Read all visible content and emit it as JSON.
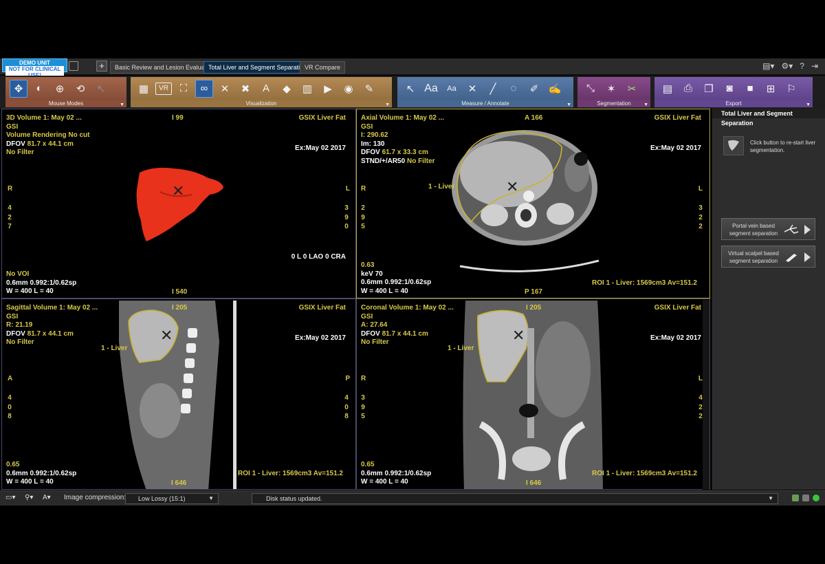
{
  "titlebar": {
    "demo_line1": "DEMO UNIT",
    "demo_line2": "NOT FOR CLINICAL USE!",
    "add_tab": "+",
    "tabs": [
      {
        "label": "Basic Review and Lesion Evaluation"
      },
      {
        "label": "Total Liver and Segment Separation"
      },
      {
        "label": "VR Compare"
      }
    ],
    "right_icons": [
      "display-icon",
      "gear-icon",
      "help-icon",
      "exit-icon"
    ]
  },
  "toolbar": {
    "groups": [
      {
        "label": "Mouse Modes",
        "color": "#8a4f3a",
        "icons": [
          "pan-icon",
          "brightness-icon",
          "zoom-icon",
          "rotate-icon",
          "pointer-icon"
        ]
      },
      {
        "label": "Visualization",
        "color": "#9a7440",
        "icons": [
          "layout-icon",
          "vr-icon",
          "fullscreen-icon",
          "link-icon",
          "crosshair-icon",
          "reference-icon",
          "annotation-icon",
          "cube-icon",
          "volume-icon",
          "cine-icon",
          "filter-icon",
          "paint-icon"
        ]
      },
      {
        "label": "Measure / Annotate",
        "color": "#46678f",
        "icons": [
          "arrow-icon",
          "text-icon",
          "text-small-icon",
          "cross-icon",
          "line-icon",
          "ellipse-icon",
          "pen-icon",
          "freehand-icon"
        ]
      },
      {
        "label": "Segmentation",
        "color": "#6e3a70",
        "icons": [
          "spline-icon",
          "magic-wand-icon",
          "scissors-icon"
        ]
      },
      {
        "label": "Export",
        "color": "#624690",
        "icons": [
          "report-icon",
          "print-icon",
          "copy-icon",
          "camera-icon",
          "video-icon",
          "save-icon",
          "run-icon"
        ]
      }
    ]
  },
  "viewports": {
    "vr3d": {
      "tl": [
        "3D Volume 1: May 02 ...",
        "GSI",
        "Volume Rendering No cut",
        "DFOV ",
        "81.7 x 44.1 cm",
        "No Filter"
      ],
      "top_center": "I 99",
      "tr": "GSIX Liver Fat",
      "exam": "Ex:May 02 2017",
      "left_orient": "R",
      "right_orient": "L",
      "left_nums": [
        "4",
        "2",
        "7"
      ],
      "right_nums": [
        "3",
        "9",
        "0"
      ],
      "angles": "0 L 0 LAO 0 CRA",
      "bl": [
        "No VOI",
        "0.6mm 0.992:1/0.62sp",
        "W = 400 L = 40"
      ],
      "bottom_center": "I 540"
    },
    "axial": {
      "tl": [
        "Axial Volume 1: May 02 ...",
        "GSI",
        "I: 290.62",
        "Im: 130",
        "DFOV ",
        "61.7 x 33.3 cm",
        "STND/+/AR50 ",
        "No Filter"
      ],
      "top_center": "A 166",
      "tr": "GSIX Liver Fat",
      "exam": "Ex:May 02 2017",
      "left_orient": "R",
      "right_orient": "L",
      "left_nums": [
        "2",
        "9",
        "5"
      ],
      "right_nums": [
        "3",
        "2",
        "2"
      ],
      "roi_label": "1 - Liver",
      "bl": [
        "0.63",
        "keV 70",
        "0.6mm 0.992:1/0.62sp",
        "W = 400 L = 40"
      ],
      "roi_stats": "ROI 1 - Liver: 1569cm3 Av=151.2",
      "bottom_center": "P 167"
    },
    "sagittal": {
      "tl": [
        "Sagittal Volume 1: May 02 ...",
        "GSI",
        "R: 21.19",
        "DFOV ",
        "81.7 x 44.1 cm",
        "No Filter"
      ],
      "top_center": "I 205",
      "tr": "GSIX Liver Fat",
      "exam": "Ex:May 02 2017",
      "left_orient": "A",
      "right_orient": "P",
      "left_nums": [
        "4",
        "0",
        "8"
      ],
      "right_nums": [
        "4",
        "0",
        "8"
      ],
      "roi_label": "1 - Liver",
      "bl": [
        "0.65",
        "0.6mm 0.992:1/0.62sp",
        "W = 400 L = 40"
      ],
      "roi_stats": "ROI 1 - Liver: 1569cm3 Av=151.2",
      "bottom_center": "I 646"
    },
    "coronal": {
      "tl": [
        "Coronal Volume 1: May 02 ...",
        "GSI",
        "A: 27.64",
        "DFOV ",
        "81.7 x 44.1 cm",
        "No Filter"
      ],
      "top_center": "I 205",
      "tr": "GSIX Liver Fat",
      "exam": "Ex:May 02 2017",
      "left_orient": "R",
      "right_orient": "L",
      "left_nums": [
        "3",
        "9",
        "5"
      ],
      "right_nums": [
        "4",
        "2",
        "2"
      ],
      "roi_label": "1 - Liver",
      "bl": [
        "0.65",
        "0.6mm 0.992:1/0.62sp",
        "W = 400 L = 40"
      ],
      "roi_stats": "ROI 1 - Liver: 1569cm3 Av=151.2",
      "bottom_center": "I 646"
    }
  },
  "right_panel": {
    "title": "Total Liver and Segment Separation",
    "liver_help": "Click button to re-start liver segmentation.",
    "portal_btn": "Portal vein based segment separation",
    "scalpel_btn": "Virtual scalpel based segment separation"
  },
  "statusbar": {
    "compression_label": "Image compression:",
    "compression_value": "Low Lossy (15:1)",
    "status_message": "Disk status updated."
  },
  "colors": {
    "overlay_text": "#d7c84a",
    "roi_outline": "#c9b330",
    "liver_render": "#e8321b",
    "active_viewport_border": "#b8a640"
  }
}
